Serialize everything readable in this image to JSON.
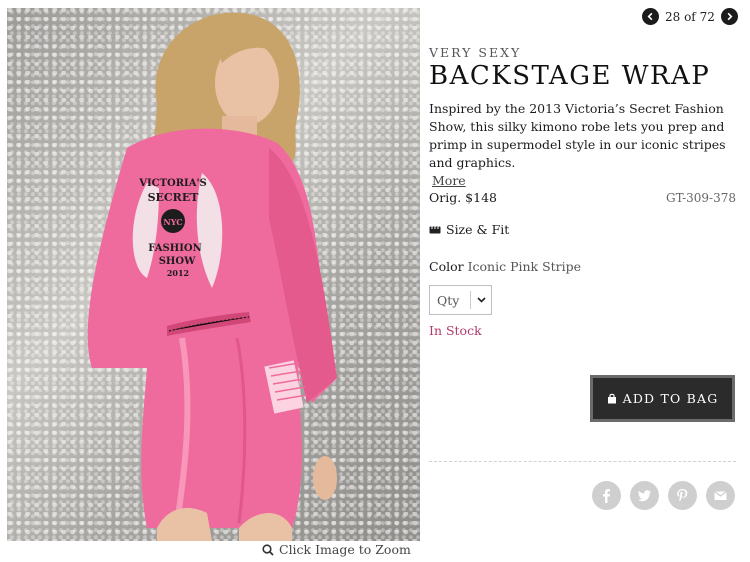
{
  "pager": {
    "count_label": "28 of 72"
  },
  "product": {
    "subtitle": "VERY SEXY",
    "title": "BACKSTAGE WRAP",
    "description": "Inspired by the 2013 Victoria’s Secret Fashion Show, this silky kimono robe lets you prep and primp in supermodel style in our iconic stripes and graphics.",
    "more_label": "More",
    "price_label": "Orig. $148",
    "sku": "GT-309-378",
    "size_fit_label": "Size & Fit",
    "color_label": "Color",
    "color_value": "Iconic Pink Stripe",
    "qty_label": "Qty",
    "stock_status": "In Stock",
    "add_to_bag_label": "ADD TO BAG"
  },
  "image": {
    "zoom_hint": "Click Image to Zoom",
    "robe_print": [
      "VICTORIA'S",
      "SECRET",
      "NYC",
      "FASHION",
      "SHOW",
      "2012"
    ]
  },
  "social": [
    "facebook-icon",
    "twitter-icon",
    "pinterest-icon",
    "email-icon"
  ],
  "colors": {
    "accent_pink": "#b0396c",
    "button_bg": "#2b2b2b",
    "robe_pink": "#f06b9d"
  }
}
